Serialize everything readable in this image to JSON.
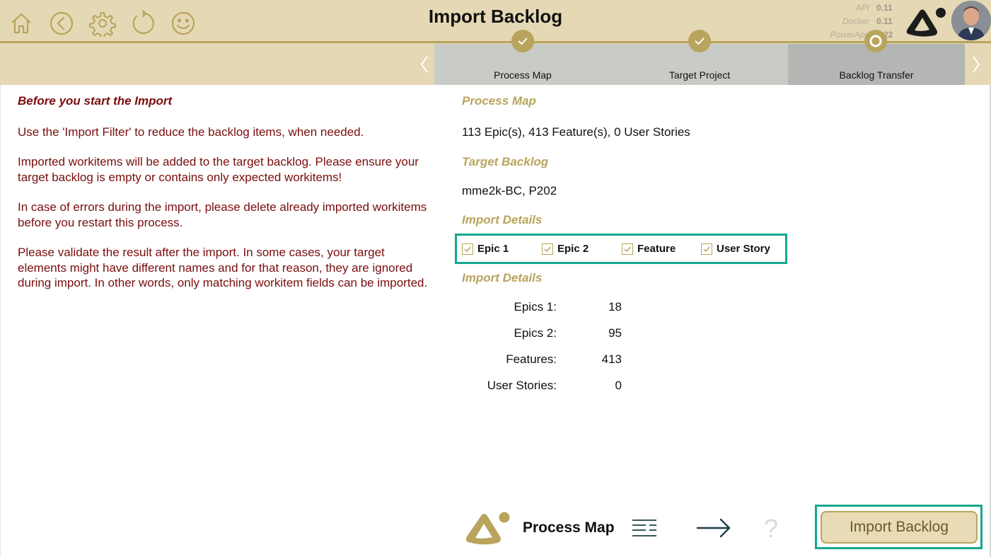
{
  "header": {
    "title": "Import Backlog",
    "versions": [
      {
        "label": "API",
        "value": "0.11"
      },
      {
        "label": "Docker",
        "value": "0.11"
      },
      {
        "label": "PowerApp",
        "value": "2.22"
      }
    ],
    "accent_color": "#b8a45c",
    "background_color": "#e5d8b5"
  },
  "nav_icons": [
    "home-icon",
    "back-icon",
    "settings-icon",
    "refresh-icon",
    "smiley-icon"
  ],
  "stepper": {
    "steps": [
      {
        "label": "Process Map",
        "state": "done"
      },
      {
        "label": "Target Project",
        "state": "done"
      },
      {
        "label": "Backlog Transfer",
        "state": "current"
      }
    ]
  },
  "instructions": {
    "heading": "Before you start the Import",
    "paragraphs": [
      "Use the 'Import Filter' to reduce the backlog items, when needed.",
      "Imported workitems will be added to the target backlog. Please ensure your target backlog is empty or contains only expected workitems!",
      "In case of errors during the import, please delete already imported workitems before you restart this process.",
      "Please validate the result after the import. In some cases, your target elements might have different names and for that reason, they are ignored during import. In other words, only matching workitem fields can be imported."
    ]
  },
  "summary": {
    "process_map_title": "Process Map",
    "process_map_value": "113 Epic(s), 413 Feature(s), 0 User Stories",
    "target_backlog_title": "Target Backlog",
    "target_backlog_value": "mme2k-BC, P202",
    "filter_title": "Import Details",
    "filters": [
      {
        "label": "Epic 1",
        "checked": true
      },
      {
        "label": "Epic 2",
        "checked": true
      },
      {
        "label": "Feature",
        "checked": true
      },
      {
        "label": "User Story",
        "checked": true
      }
    ],
    "details_title": "Import Details",
    "details": [
      {
        "label": "Epics 1:",
        "value": "18"
      },
      {
        "label": "Epics 2:",
        "value": "95"
      },
      {
        "label": "Features:",
        "value": "413"
      },
      {
        "label": "User Stories:",
        "value": "0"
      }
    ]
  },
  "footer": {
    "app_name": "Process Map",
    "import_button": "Import Backlog",
    "help_glyph": "?"
  }
}
